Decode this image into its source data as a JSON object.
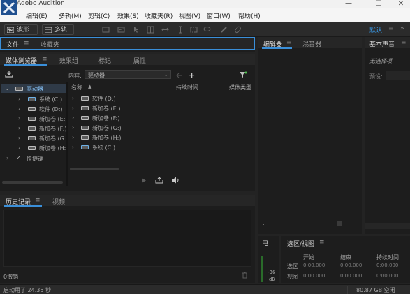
{
  "window": {
    "title": "Adobe Audition",
    "buttons": [
      "—",
      "☐",
      "✕"
    ]
  },
  "menubar": {
    "items": [
      "编辑(E)",
      "多轨(M)",
      "剪辑(C)",
      "效果(S)",
      "收藏夹(R)",
      "视图(V)",
      "窗口(W)",
      "帮助(H)"
    ]
  },
  "toolbar": {
    "waveform_label": "波形",
    "multitrack_label": "多轨",
    "workspace_label": "默认"
  },
  "left_top_panel": {
    "tabs": [
      "文件",
      "收藏夹"
    ]
  },
  "browser_panel": {
    "tabs": [
      "媒体浏览器",
      "效果组",
      "标记",
      "属性"
    ],
    "content_label": "内容:",
    "content_value": "驱动器",
    "columns": [
      "名称",
      "持续时间",
      "媒体类型"
    ],
    "tree": [
      {
        "label": "驱动器",
        "level": 0
      },
      {
        "label": "系统 (C:)",
        "level": 1
      },
      {
        "label": "软件 (D:)",
        "level": 1
      },
      {
        "label": "新加卷 (E:)",
        "level": 1
      },
      {
        "label": "新加卷 (F:)",
        "level": 1
      },
      {
        "label": "新加卷 (G:)",
        "level": 1
      },
      {
        "label": "新加卷 (H:)",
        "level": 1
      },
      {
        "label": "快捷键",
        "level": 0
      }
    ],
    "list": [
      "软件 (D:)",
      "新加卷 (E:)",
      "新加卷 (F:)",
      "新加卷 (G:)",
      "新加卷 (H:)",
      "系统 (C:)"
    ]
  },
  "history_panel": {
    "tabs": [
      "历史记录",
      "视频"
    ],
    "undo_label": "0撤销"
  },
  "editor_panel": {
    "tabs": [
      "编辑器",
      "混音器"
    ]
  },
  "basic_sound_panel": {
    "title": "基本声音",
    "no_selection": "无选择项",
    "preset_label": "预设:"
  },
  "meter_panel": {
    "title": "电",
    "scale": [
      "-36",
      "dB"
    ]
  },
  "selection_panel": {
    "title": "选区/视图",
    "columns": [
      "开始",
      "结束",
      "持续时间"
    ],
    "rows": [
      {
        "label": "选区",
        "values": [
          "0:00.000",
          "0:00.000",
          "0:00.000"
        ]
      },
      {
        "label": "视图",
        "values": [
          "0:00.000",
          "0:00.000",
          "0:00.000"
        ]
      }
    ]
  },
  "statusbar": {
    "left": "启动用了 24.35 秒",
    "right": "80.87 GB 空闲"
  }
}
